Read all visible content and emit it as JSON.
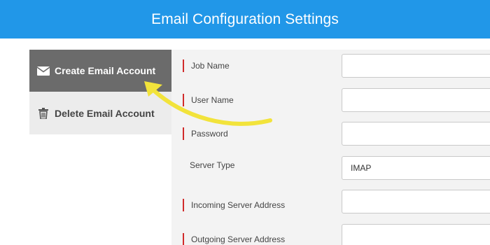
{
  "header": {
    "title": "Email Configuration Settings"
  },
  "sidebar": {
    "items": [
      {
        "label": "Create Email Account",
        "icon": "envelope-icon",
        "active": true
      },
      {
        "label": "Delete Email Account",
        "icon": "trash-icon",
        "active": false
      }
    ]
  },
  "form": {
    "fields": [
      {
        "label": "Job Name",
        "required": true,
        "value": ""
      },
      {
        "label": "User Name",
        "required": true,
        "value": ""
      },
      {
        "label": "Password",
        "required": true,
        "value": ""
      },
      {
        "label": "Server Type",
        "required": false,
        "value": "IMAP"
      },
      {
        "label": "Incoming Server Address",
        "required": true,
        "value": ""
      },
      {
        "label": "Outgoing Server Address",
        "required": true,
        "value": ""
      }
    ]
  },
  "annotation": {
    "arrow_color": "#f2e33b"
  },
  "colors": {
    "header_bg": "#2197e8",
    "active_item_bg": "#6b6b6b",
    "required_marker": "#d12b2b"
  }
}
